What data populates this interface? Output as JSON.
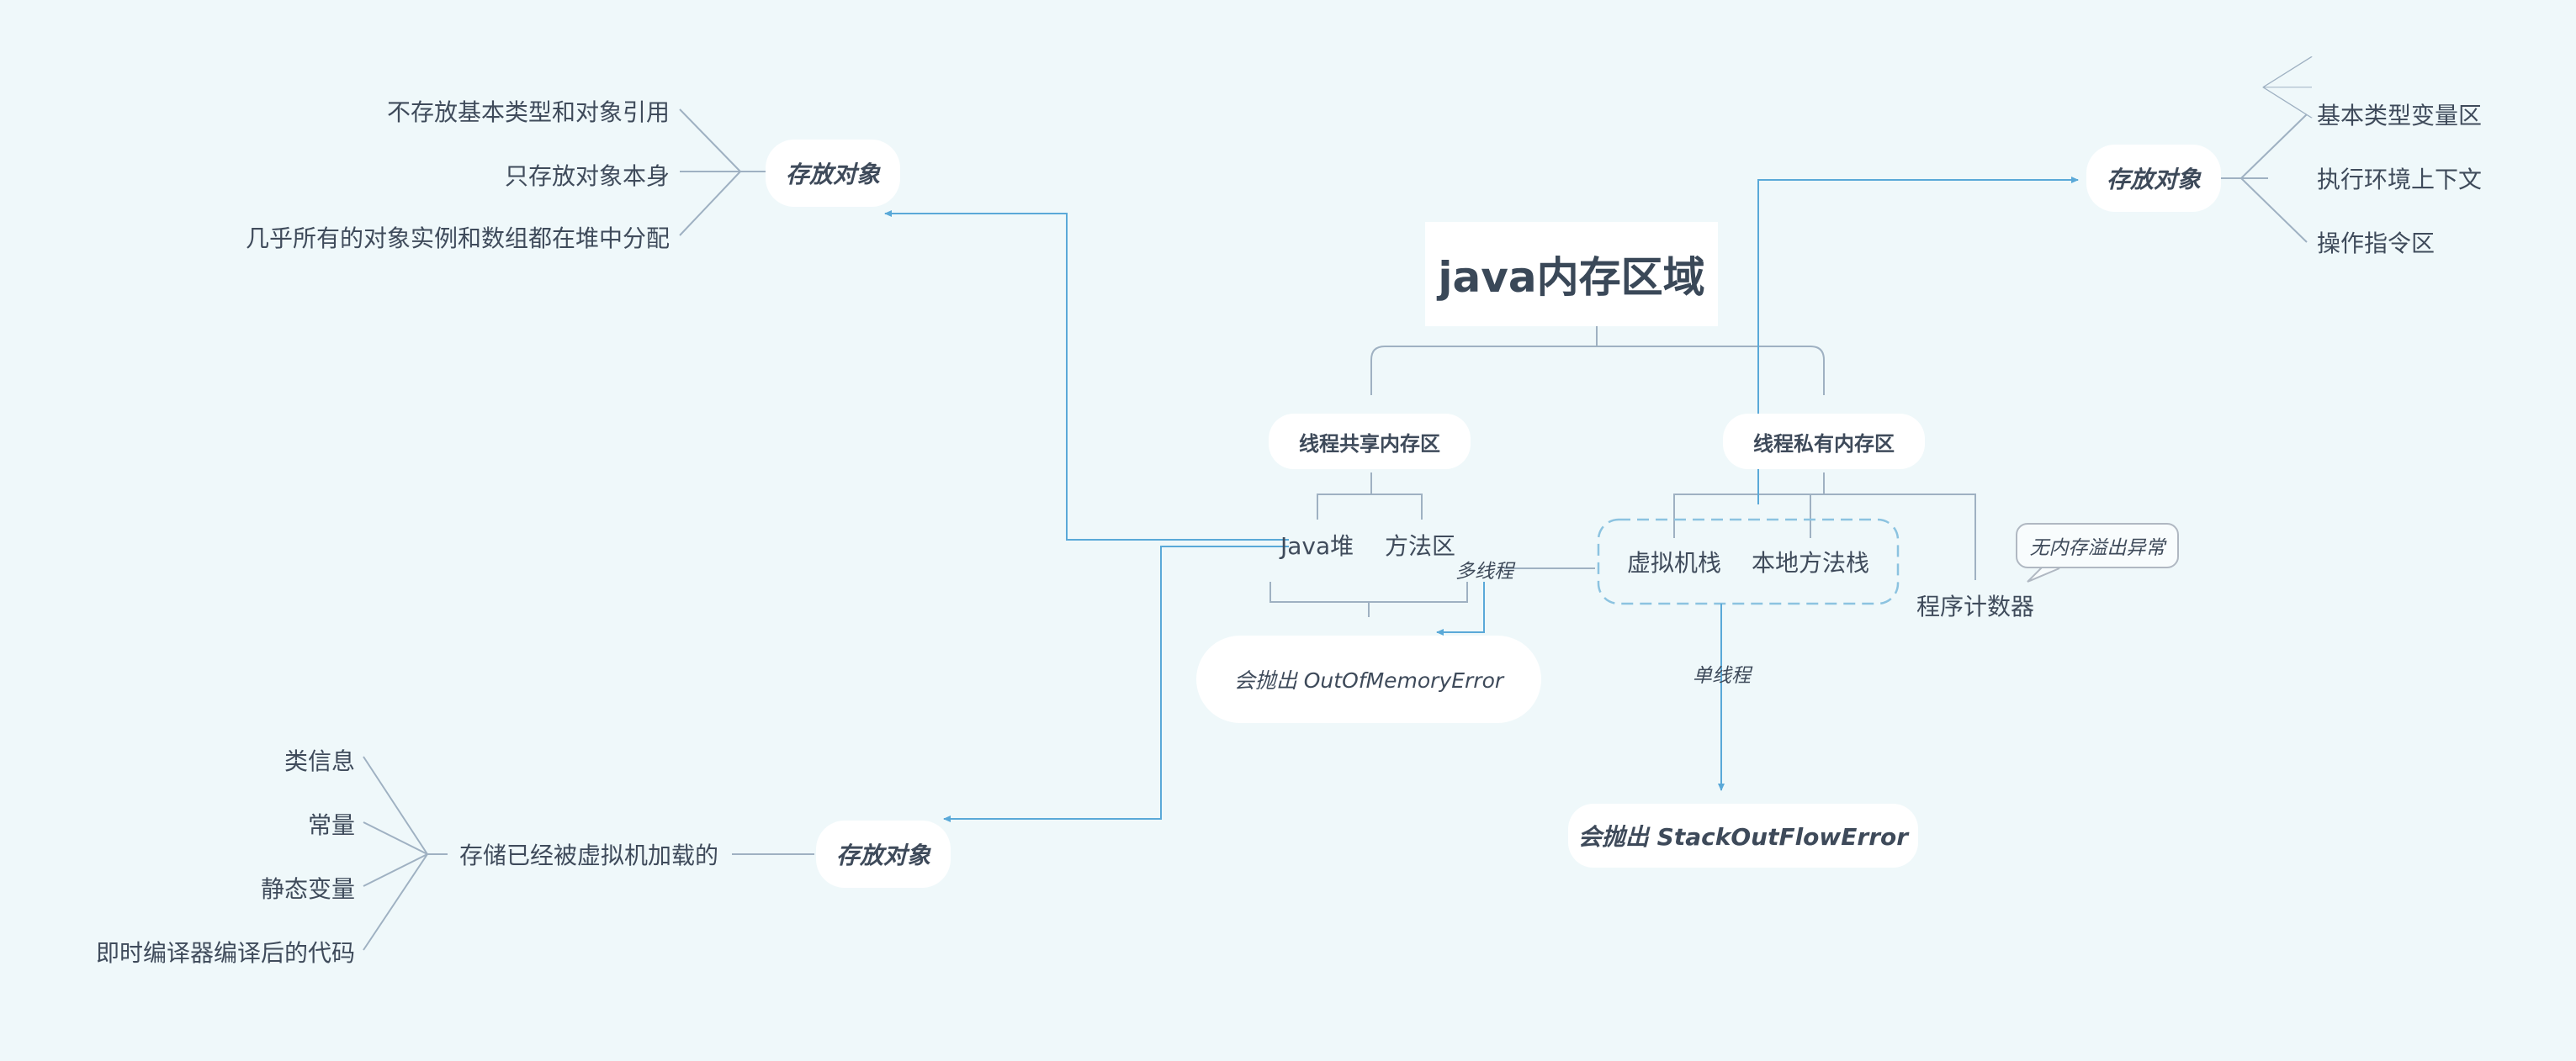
{
  "root": {
    "title": "java内存区域"
  },
  "shared": {
    "title": "线程共享内存区",
    "heap": "Java堆",
    "method_area": "方法区",
    "multithread_label": "多线程",
    "oom": "会抛出 OutOfMemoryError"
  },
  "private": {
    "title": "线程私有内存区",
    "vm_stack": "虚拟机栈",
    "native_stack": "本地方法栈",
    "pc": "程序计数器",
    "pc_note": "无内存溢出异常",
    "singlethread_label": "单线程",
    "soe": "会抛出 StackOutFlowError"
  },
  "heap_store": {
    "title": "存放对象",
    "items": [
      "不存放基本类型和对象引用",
      "只存放对象本身",
      "几乎所有的对象实例和数组都在堆中分配"
    ]
  },
  "method_store": {
    "title": "存放对象",
    "desc": "存储已经被虚拟机加载的",
    "items": [
      "类信息",
      "常量",
      "静态变量",
      "即时编译器编译后的代码"
    ]
  },
  "stack_store": {
    "title": "存放对象",
    "items": [
      "基本类型变量区",
      "执行环境上下文",
      "操作指令区"
    ]
  },
  "colors": {
    "background": "#eff8fa",
    "tree_line": "#9fb1c2",
    "arrow": "#5aa9d8",
    "dashed": "#8cc3e0"
  }
}
